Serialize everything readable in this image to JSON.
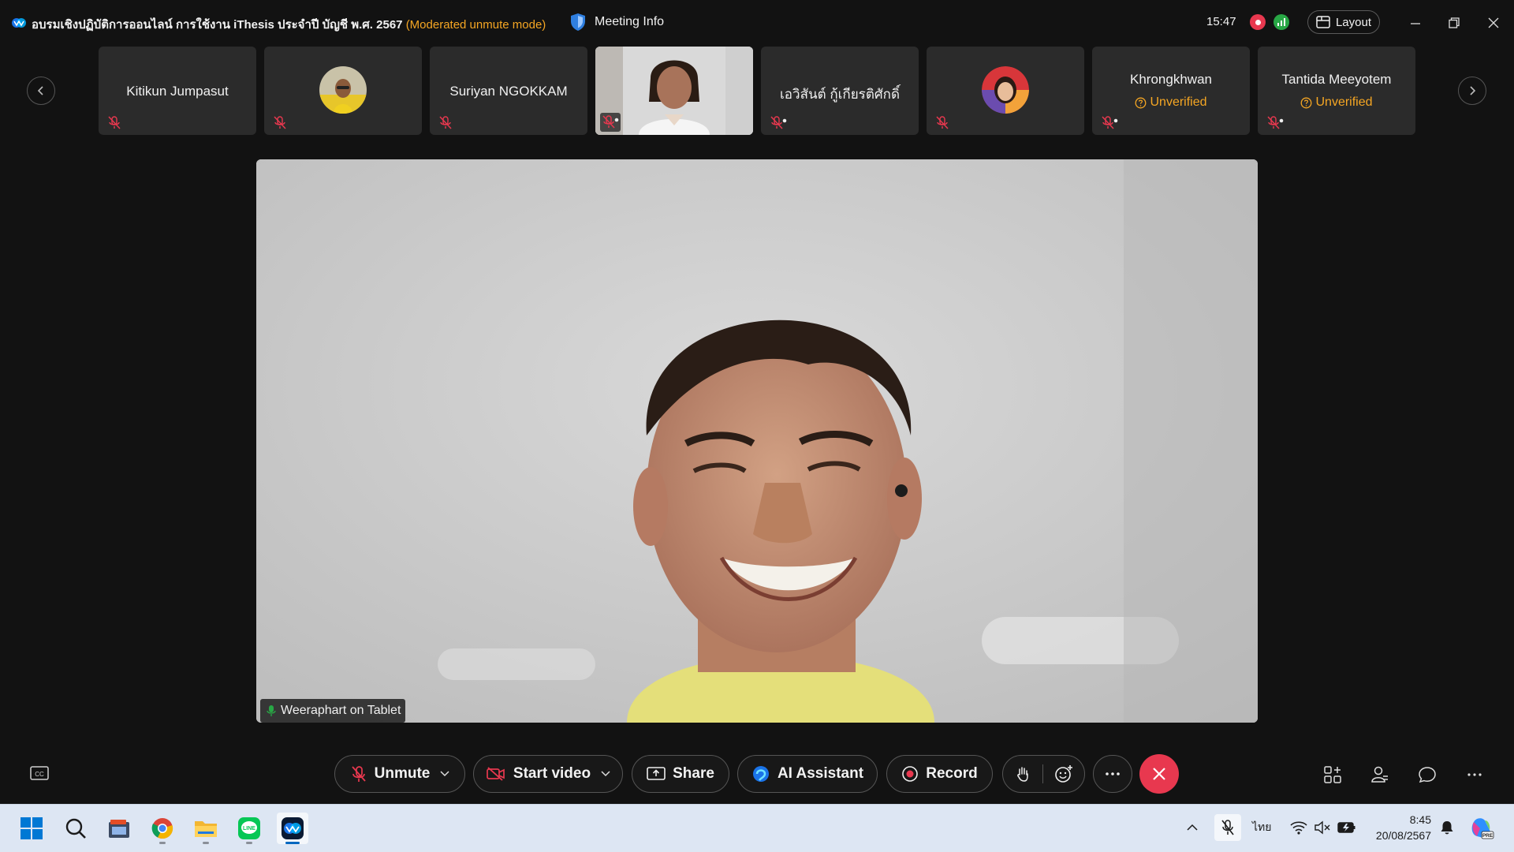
{
  "titlebar": {
    "title": "อบรมเชิงปฏิบัติการออนไลน์ การใช้งาน iThesis ประจำปี บัญชี พ.ศ. 2567",
    "mode": "(Moderated unmute mode)",
    "meeting_info": "Meeting Info",
    "time": "15:47",
    "layout_label": "Layout"
  },
  "participants": [
    {
      "name": "Kitikun Jumpasut",
      "type": "name",
      "unverified": ""
    },
    {
      "name": "",
      "type": "avatar",
      "unverified": ""
    },
    {
      "name": "Suriyan NGOKKAM",
      "type": "name",
      "unverified": ""
    },
    {
      "name": "",
      "type": "video",
      "unverified": ""
    },
    {
      "name": "เอวิสันต์ กู้เกียรติศักดิ์",
      "type": "name",
      "unverified": ""
    },
    {
      "name": "",
      "type": "avatar",
      "unverified": ""
    },
    {
      "name": "Khrongkhwan",
      "type": "name",
      "unverified": "Unverified"
    },
    {
      "name": "Tantida Meeyotem",
      "type": "name",
      "unverified": "Unverified"
    }
  ],
  "main_video": {
    "speaker": "Weeraphart on Tablet"
  },
  "controls": {
    "unmute": "Unmute",
    "start_video": "Start video",
    "share": "Share",
    "ai_assistant": "AI Assistant",
    "record": "Record"
  },
  "taskbar": {
    "language": "ไทย",
    "time": "8:45",
    "date": "20/08/2567"
  },
  "colors": {
    "accent_orange": "#f5a623",
    "end_red": "#e8384f",
    "net_green": "#28a745"
  }
}
